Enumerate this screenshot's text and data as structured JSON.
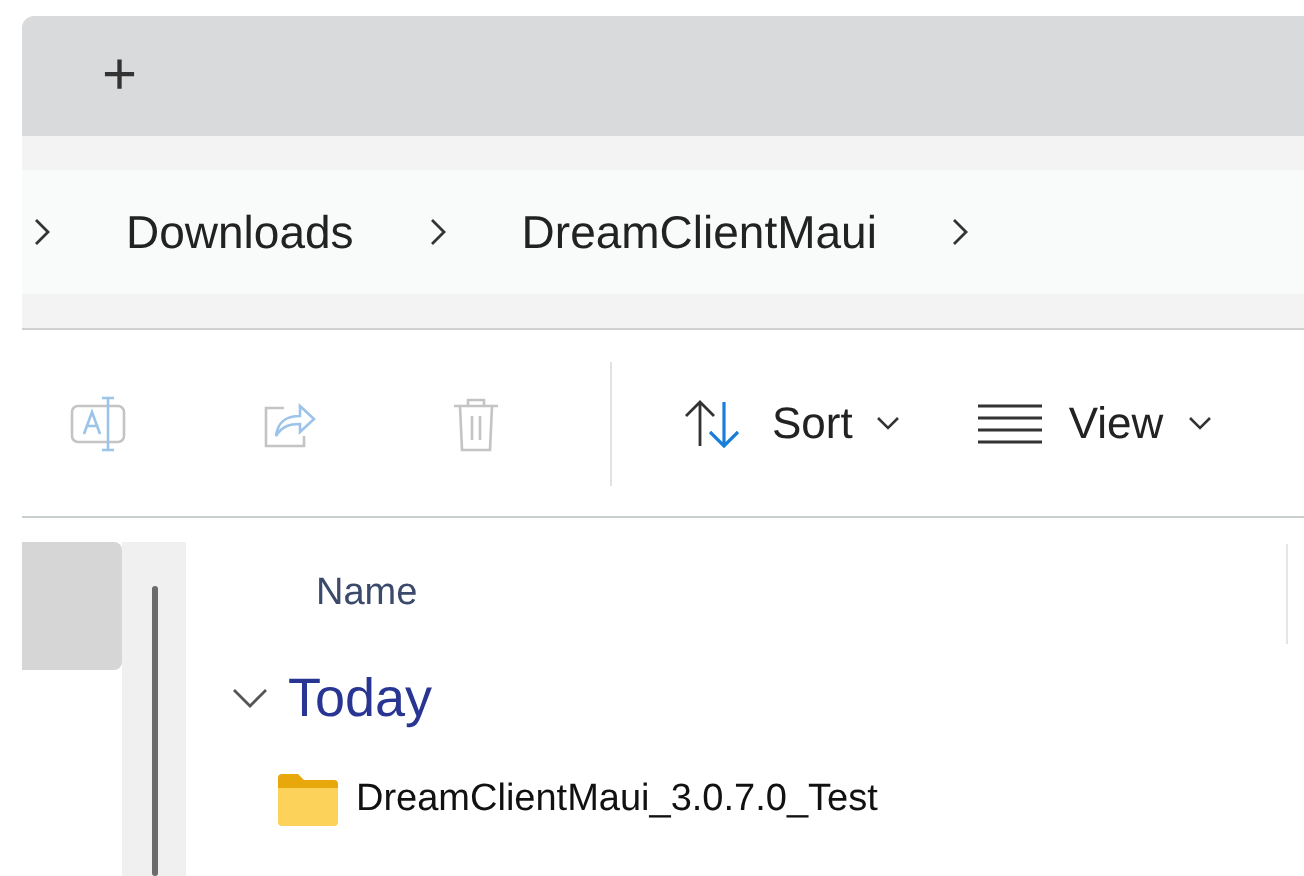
{
  "tab_bar": {
    "new_tab": "+"
  },
  "breadcrumb": {
    "segments": [
      {
        "label": "Downloads"
      },
      {
        "label": "DreamClientMaui"
      }
    ]
  },
  "toolbar": {
    "items": [
      {
        "kind": "rename",
        "disabled": true
      },
      {
        "kind": "share",
        "disabled": true
      },
      {
        "kind": "delete",
        "disabled": true
      },
      {
        "kind": "sort",
        "label": "Sort",
        "disabled": false
      },
      {
        "kind": "view",
        "label": "View",
        "disabled": false
      }
    ]
  },
  "sidebar": {
    "items": [
      {
        "selected": true
      }
    ]
  },
  "file_list": {
    "columns": [
      "Name"
    ],
    "groups": [
      {
        "label": "Today",
        "expanded": true,
        "items": [
          {
            "kind": "folder",
            "name": "DreamClientMaui_3.0.7.0_Test"
          }
        ]
      }
    ]
  }
}
